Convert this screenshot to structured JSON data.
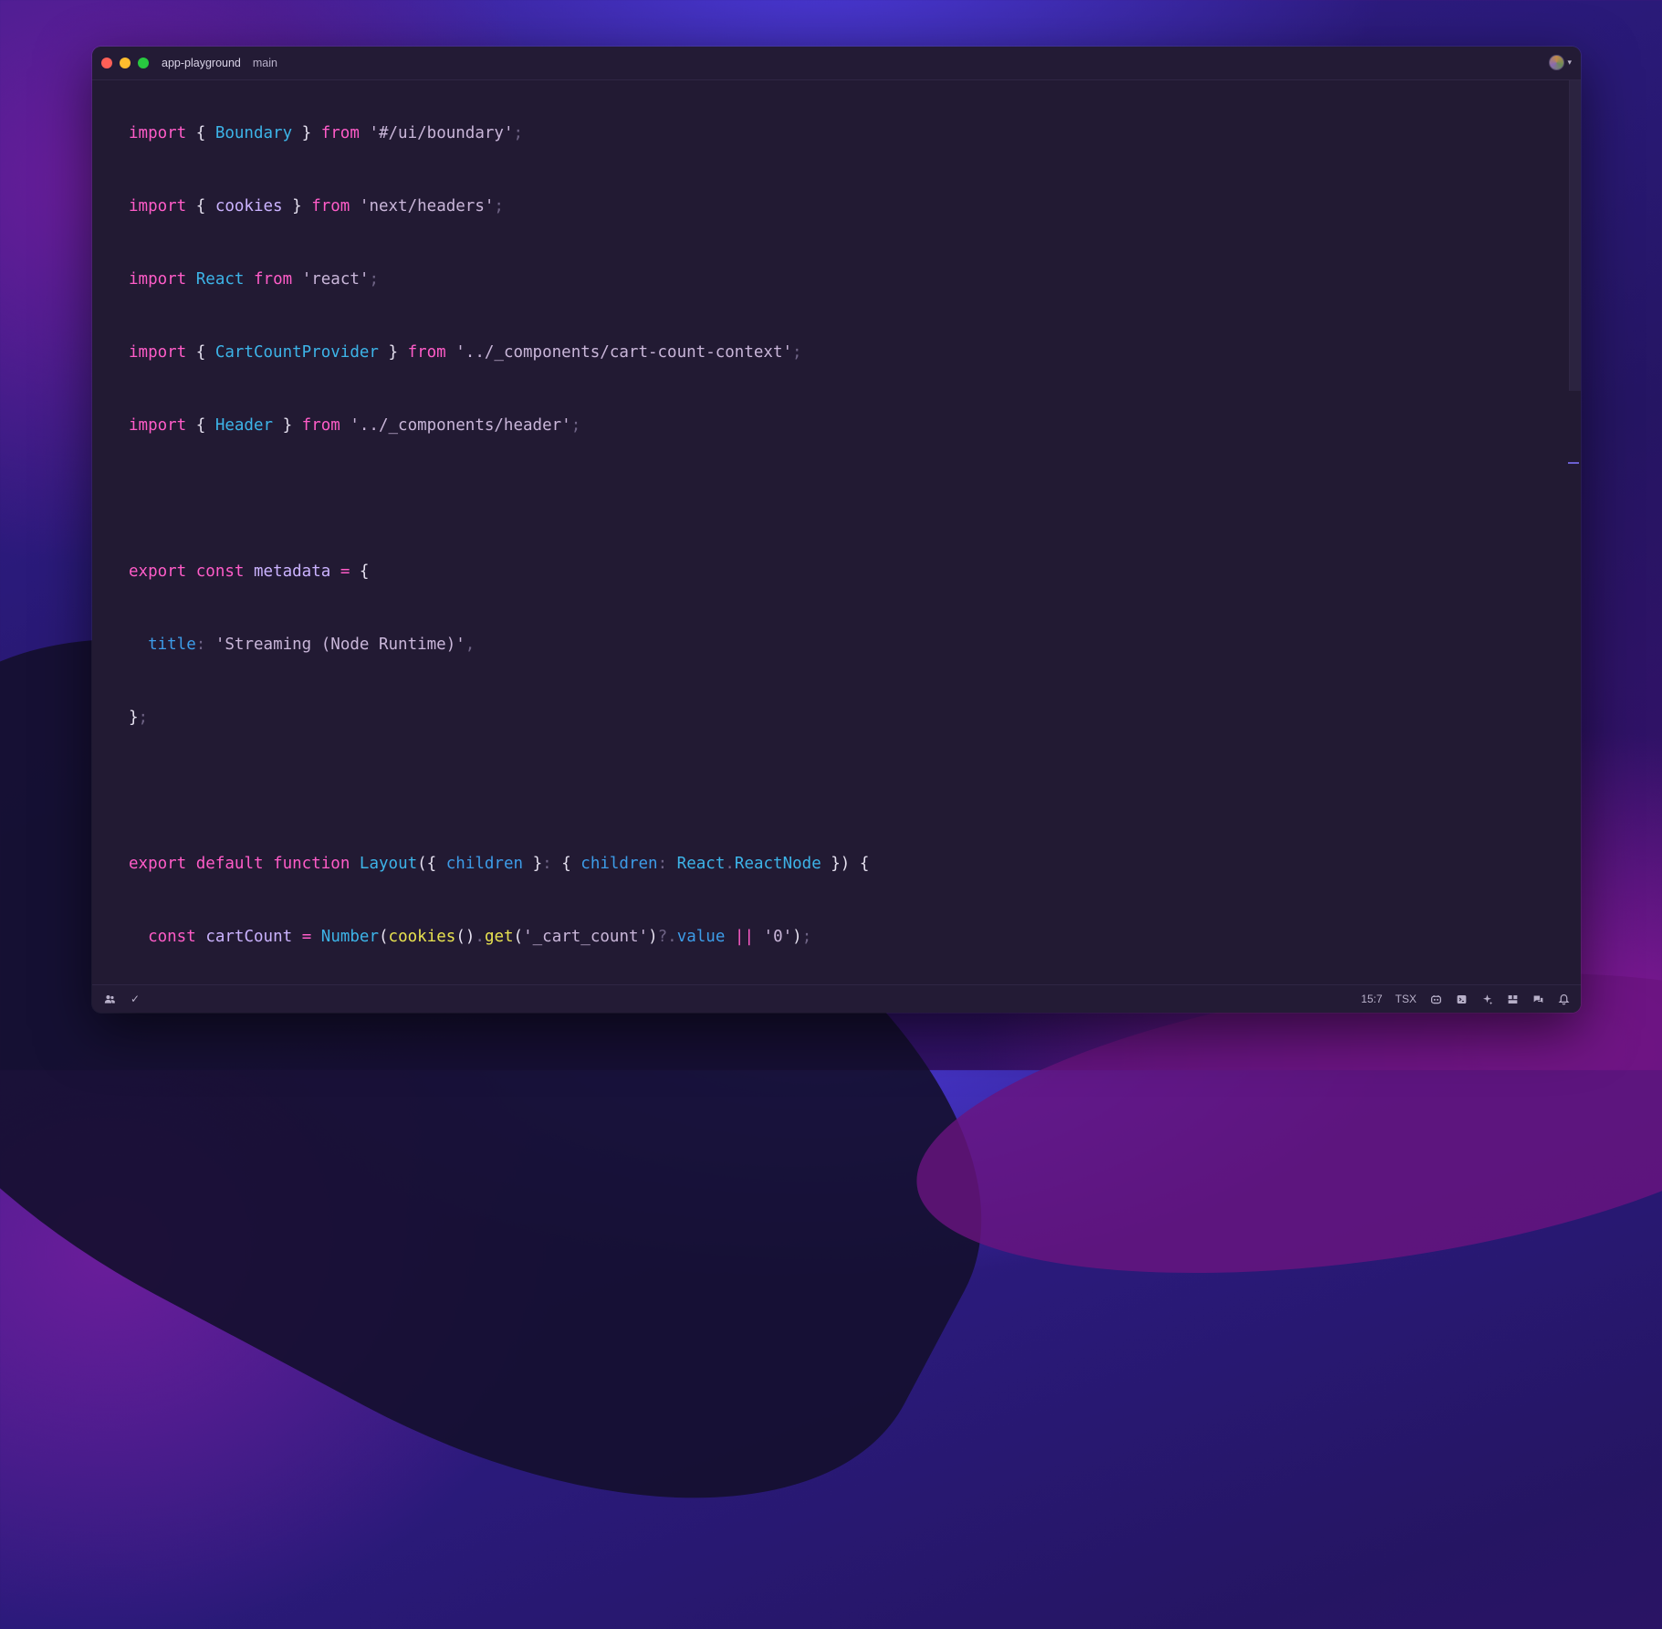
{
  "window": {
    "project": "app-playground",
    "branch": "main"
  },
  "colors": {
    "keyword": "#ff5cc8",
    "type": "#3db4e8",
    "string": "#c9b6d9",
    "function": "#e9e350",
    "background": "#221a33"
  },
  "editor": {
    "lines": [
      [
        [
          "kw",
          "import"
        ],
        [
          "pun",
          " { "
        ],
        [
          "cls",
          "Boundary"
        ],
        [
          "pun",
          " } "
        ],
        [
          "kw",
          "from"
        ],
        [
          "pun",
          " "
        ],
        [
          "str",
          "'#/ui/boundary'"
        ],
        [
          "dim",
          ";"
        ]
      ],
      [
        [
          "kw",
          "import"
        ],
        [
          "pun",
          " { "
        ],
        [
          "var",
          "cookies"
        ],
        [
          "pun",
          " } "
        ],
        [
          "kw",
          "from"
        ],
        [
          "pun",
          " "
        ],
        [
          "str",
          "'next/headers'"
        ],
        [
          "dim",
          ";"
        ]
      ],
      [
        [
          "kw",
          "import"
        ],
        [
          "pun",
          " "
        ],
        [
          "cls",
          "React"
        ],
        [
          "pun",
          " "
        ],
        [
          "kw",
          "from"
        ],
        [
          "pun",
          " "
        ],
        [
          "str",
          "'react'"
        ],
        [
          "dim",
          ";"
        ]
      ],
      [
        [
          "kw",
          "import"
        ],
        [
          "pun",
          " { "
        ],
        [
          "cls",
          "CartCountProvider"
        ],
        [
          "pun",
          " } "
        ],
        [
          "kw",
          "from"
        ],
        [
          "pun",
          " "
        ],
        [
          "str",
          "'../_components/cart-count-context'"
        ],
        [
          "dim",
          ";"
        ]
      ],
      [
        [
          "kw",
          "import"
        ],
        [
          "pun",
          " { "
        ],
        [
          "cls",
          "Header"
        ],
        [
          "pun",
          " } "
        ],
        [
          "kw",
          "from"
        ],
        [
          "pun",
          " "
        ],
        [
          "str",
          "'../_components/header'"
        ],
        [
          "dim",
          ";"
        ]
      ],
      [],
      [
        [
          "kw",
          "export"
        ],
        [
          "pun",
          " "
        ],
        [
          "kw",
          "const"
        ],
        [
          "pun",
          " "
        ],
        [
          "var",
          "metadata"
        ],
        [
          "pun",
          " "
        ],
        [
          "kw",
          "="
        ],
        [
          "pun",
          " {"
        ]
      ],
      [
        [
          "pun",
          "  "
        ],
        [
          "prop",
          "title"
        ],
        [
          "dim",
          ":"
        ],
        [
          "pun",
          " "
        ],
        [
          "str",
          "'Streaming (Node Runtime)'"
        ],
        [
          "dim",
          ","
        ]
      ],
      [
        [
          "pun",
          "}"
        ],
        [
          "dim",
          ";"
        ]
      ],
      [],
      [
        [
          "kw",
          "export"
        ],
        [
          "pun",
          " "
        ],
        [
          "kw",
          "default"
        ],
        [
          "pun",
          " "
        ],
        [
          "kw",
          "function"
        ],
        [
          "pun",
          " "
        ],
        [
          "cls",
          "Layout"
        ],
        [
          "pun",
          "({ "
        ],
        [
          "prop",
          "children"
        ],
        [
          "pun",
          " }"
        ],
        [
          "dim",
          ":"
        ],
        [
          "pun",
          " { "
        ],
        [
          "prop",
          "children"
        ],
        [
          "dim",
          ":"
        ],
        [
          "pun",
          " "
        ],
        [
          "cls",
          "React"
        ],
        [
          "dim",
          "."
        ],
        [
          "cls",
          "ReactNode"
        ],
        [
          "pun",
          " }) {"
        ]
      ],
      [
        [
          "pun",
          "  "
        ],
        [
          "kw",
          "const"
        ],
        [
          "pun",
          " "
        ],
        [
          "var",
          "cartCount"
        ],
        [
          "pun",
          " "
        ],
        [
          "kw",
          "="
        ],
        [
          "pun",
          " "
        ],
        [
          "cls",
          "Number"
        ],
        [
          "pun",
          "("
        ],
        [
          "fn",
          "cookies"
        ],
        [
          "pun",
          "()"
        ],
        [
          "dim",
          "."
        ],
        [
          "fn",
          "get"
        ],
        [
          "pun",
          "("
        ],
        [
          "str",
          "'_cart_count'"
        ],
        [
          "pun",
          ")"
        ],
        [
          "dim",
          "?."
        ],
        [
          "prop",
          "value"
        ],
        [
          "pun",
          " "
        ],
        [
          "kw",
          "||"
        ],
        [
          "pun",
          " "
        ],
        [
          "str",
          "'0'"
        ],
        [
          "pun",
          ")"
        ],
        [
          "dim",
          ";"
        ]
      ]
    ]
  },
  "statusbar": {
    "cursor": "15:7",
    "language": "TSX",
    "check": "✓"
  }
}
